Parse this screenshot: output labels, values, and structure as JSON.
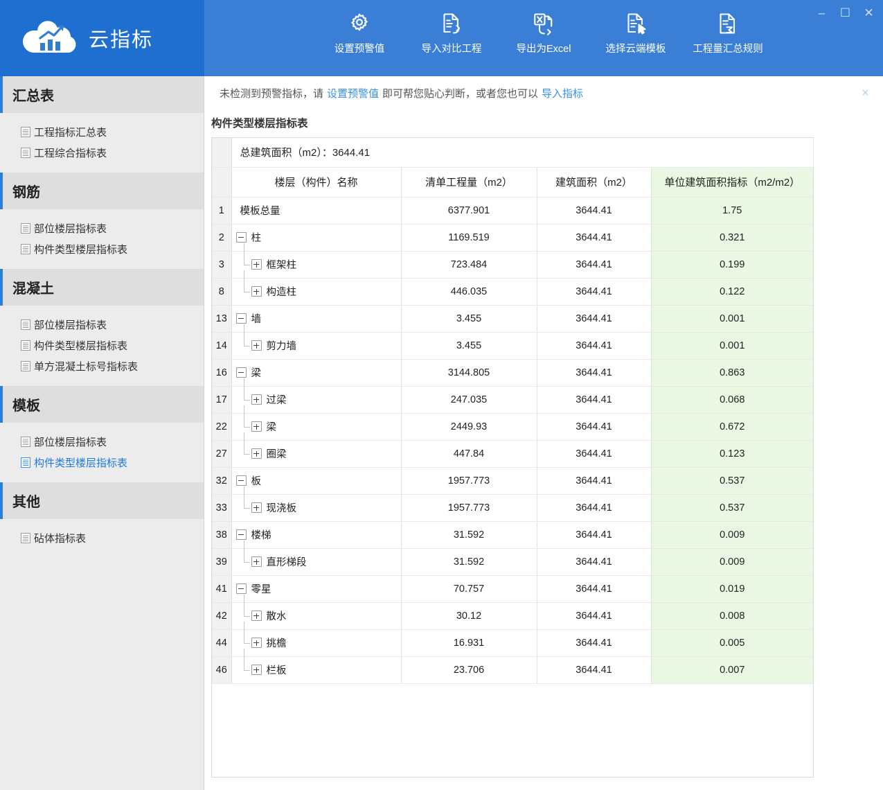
{
  "window": {
    "minimize_label": "–",
    "maximize_label": "☐",
    "close_label": "×"
  },
  "brand": {
    "title": "云指标",
    "logo_icon": "cloud-chart-logo",
    "bg_color": "#1f6fd0"
  },
  "toolbar": {
    "bg_color": "#3a7fd5",
    "items": [
      {
        "label": "设置预警值",
        "icon": "gear-icon"
      },
      {
        "label": "导入对比工程",
        "icon": "document-import-icon"
      },
      {
        "label": "导出为Excel",
        "icon": "excel-export-icon"
      },
      {
        "label": "选择云端模板",
        "icon": "document-cursor-icon"
      },
      {
        "label": "工程量汇总规则",
        "icon": "document-sigma-icon"
      }
    ]
  },
  "sidebar": {
    "groups": [
      {
        "title": "汇总表",
        "items": [
          {
            "label": "工程指标汇总表",
            "active": false
          },
          {
            "label": "工程综合指标表",
            "active": false
          }
        ]
      },
      {
        "title": "钢筋",
        "items": [
          {
            "label": "部位楼层指标表",
            "active": false
          },
          {
            "label": "构件类型楼层指标表",
            "active": false
          }
        ]
      },
      {
        "title": "混凝土",
        "items": [
          {
            "label": "部位楼层指标表",
            "active": false
          },
          {
            "label": "构件类型楼层指标表",
            "active": false
          },
          {
            "label": "单方混凝土标号指标表",
            "active": false
          }
        ]
      },
      {
        "title": "模板",
        "items": [
          {
            "label": "部位楼层指标表",
            "active": false
          },
          {
            "label": "构件类型楼层指标表",
            "active": true
          }
        ]
      },
      {
        "title": "其他",
        "items": [
          {
            "label": "砧体指标表",
            "active": false
          }
        ]
      }
    ]
  },
  "notice": {
    "text_before": "未检测到预警指标，请",
    "link1": "设置预警值",
    "text_middle": "即可帮您贴心判断，或者您也可以",
    "link2": "导入指标",
    "close_label": "×"
  },
  "main": {
    "page_title": "构件类型楼层指标表",
    "summary_label": "总建筑面积（m2）：3644.41"
  },
  "table": {
    "accent_color": "#eaf7e2",
    "columns": [
      "楼层（构件）名称",
      "清单工程量（m2）",
      "建筑面积（m2）",
      "单位建筑面积指标（m2/m2）"
    ],
    "rows": [
      {
        "num": "1",
        "name": "模板总量",
        "level": 0,
        "expander": "none",
        "qty": "6377.901",
        "area": "3644.41",
        "idx": "1.75"
      },
      {
        "num": "2",
        "name": "柱",
        "level": 0,
        "expander": "minus",
        "qty": "1169.519",
        "area": "3644.41",
        "idx": "0.321"
      },
      {
        "num": "3",
        "name": "框架柱",
        "level": 1,
        "expander": "plus",
        "qty": "723.484",
        "area": "3644.41",
        "idx": "0.199"
      },
      {
        "num": "8",
        "name": "构造柱",
        "level": 1,
        "expander": "plus",
        "qty": "446.035",
        "area": "3644.41",
        "idx": "0.122"
      },
      {
        "num": "13",
        "name": "墙",
        "level": 0,
        "expander": "minus",
        "qty": "3.455",
        "area": "3644.41",
        "idx": "0.001"
      },
      {
        "num": "14",
        "name": "剪力墙",
        "level": 1,
        "expander": "plus",
        "qty": "3.455",
        "area": "3644.41",
        "idx": "0.001"
      },
      {
        "num": "16",
        "name": "梁",
        "level": 0,
        "expander": "minus",
        "qty": "3144.805",
        "area": "3644.41",
        "idx": "0.863"
      },
      {
        "num": "17",
        "name": "过梁",
        "level": 1,
        "expander": "plus",
        "qty": "247.035",
        "area": "3644.41",
        "idx": "0.068"
      },
      {
        "num": "22",
        "name": "梁",
        "level": 1,
        "expander": "plus",
        "qty": "2449.93",
        "area": "3644.41",
        "idx": "0.672"
      },
      {
        "num": "27",
        "name": "圈梁",
        "level": 1,
        "expander": "plus",
        "qty": "447.84",
        "area": "3644.41",
        "idx": "0.123"
      },
      {
        "num": "32",
        "name": "板",
        "level": 0,
        "expander": "minus",
        "qty": "1957.773",
        "area": "3644.41",
        "idx": "0.537"
      },
      {
        "num": "33",
        "name": "现浇板",
        "level": 1,
        "expander": "plus",
        "qty": "1957.773",
        "area": "3644.41",
        "idx": "0.537"
      },
      {
        "num": "38",
        "name": "楼梯",
        "level": 0,
        "expander": "minus",
        "qty": "31.592",
        "area": "3644.41",
        "idx": "0.009"
      },
      {
        "num": "39",
        "name": "直形梯段",
        "level": 1,
        "expander": "plus",
        "qty": "31.592",
        "area": "3644.41",
        "idx": "0.009"
      },
      {
        "num": "41",
        "name": "零星",
        "level": 0,
        "expander": "minus",
        "qty": "70.757",
        "area": "3644.41",
        "idx": "0.019"
      },
      {
        "num": "42",
        "name": "散水",
        "level": 1,
        "expander": "plus",
        "qty": "30.12",
        "area": "3644.41",
        "idx": "0.008"
      },
      {
        "num": "44",
        "name": "挑檐",
        "level": 1,
        "expander": "plus",
        "qty": "16.931",
        "area": "3644.41",
        "idx": "0.005"
      },
      {
        "num": "46",
        "name": "栏板",
        "level": 1,
        "expander": "plus",
        "qty": "23.706",
        "area": "3644.41",
        "idx": "0.007"
      }
    ]
  }
}
